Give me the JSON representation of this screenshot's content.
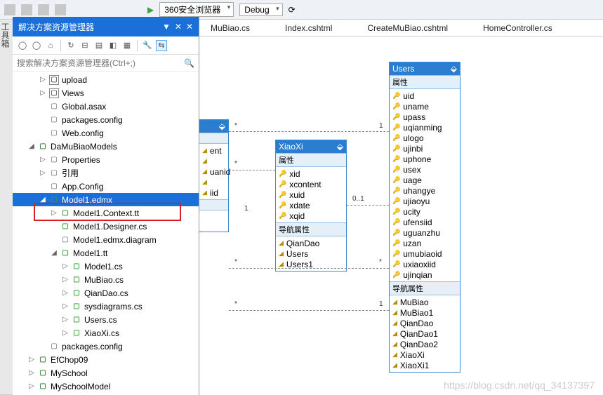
{
  "toolbar": {
    "browser": "360安全浏览器",
    "config": "Debug"
  },
  "tabs": [
    "MuBiao.cs",
    "Index.cshtml",
    "CreateMuBiao.cshtml",
    "HomeController.cs"
  ],
  "panel": {
    "title": "解决方案资源管理器",
    "search_ph": "搜索解决方案资源管理器(Ctrl+;)"
  },
  "tree": [
    {
      "d": 2,
      "a": "▷",
      "i": "f-folder",
      "t": "upload"
    },
    {
      "d": 2,
      "a": "▷",
      "i": "f-folder",
      "t": "Views"
    },
    {
      "d": 2,
      "a": "",
      "i": "f-config",
      "t": "Global.asax"
    },
    {
      "d": 2,
      "a": "",
      "i": "f-config",
      "t": "packages.config"
    },
    {
      "d": 2,
      "a": "",
      "i": "f-config",
      "t": "Web.config"
    },
    {
      "d": 1,
      "a": "◢",
      "i": "f-proj",
      "t": "DaMuBiaoModels"
    },
    {
      "d": 2,
      "a": "▷",
      "i": "f-config",
      "t": "Properties"
    },
    {
      "d": 2,
      "a": "▷",
      "i": "f-config",
      "t": "引用"
    },
    {
      "d": 2,
      "a": "",
      "i": "f-config",
      "t": "App.Config"
    },
    {
      "d": 2,
      "a": "◢",
      "i": "f-edmx",
      "t": "Model1.edmx",
      "sel": true
    },
    {
      "d": 3,
      "a": "▷",
      "i": "f-cs",
      "t": "Model1.Context.tt"
    },
    {
      "d": 3,
      "a": "",
      "i": "f-cs",
      "t": "Model1.Designer.cs"
    },
    {
      "d": 3,
      "a": "",
      "i": "f-config",
      "t": "Model1.edmx.diagram"
    },
    {
      "d": 3,
      "a": "◢",
      "i": "f-cs",
      "t": "Model1.tt"
    },
    {
      "d": 4,
      "a": "▷",
      "i": "f-cs",
      "t": "Model1.cs"
    },
    {
      "d": 4,
      "a": "▷",
      "i": "f-cs",
      "t": "MuBiao.cs"
    },
    {
      "d": 4,
      "a": "▷",
      "i": "f-cs",
      "t": "QianDao.cs"
    },
    {
      "d": 4,
      "a": "▷",
      "i": "f-cs",
      "t": "sysdiagrams.cs"
    },
    {
      "d": 4,
      "a": "▷",
      "i": "f-cs",
      "t": "Users.cs"
    },
    {
      "d": 4,
      "a": "▷",
      "i": "f-cs",
      "t": "XiaoXi.cs"
    },
    {
      "d": 2,
      "a": "",
      "i": "f-config",
      "t": "packages.config"
    },
    {
      "d": 1,
      "a": "▷",
      "i": "f-proj",
      "t": "EfChop09"
    },
    {
      "d": 1,
      "a": "▷",
      "i": "f-proj",
      "t": "MySchool"
    },
    {
      "d": 1,
      "a": "▷",
      "i": "f-proj",
      "t": "MySchoolModel"
    }
  ],
  "ent_partial": {
    "props": [
      "ent",
      "",
      "uanid",
      "",
      "iid"
    ]
  },
  "ent_xiaoxi": {
    "name": "XiaoXi",
    "sec1": "属性",
    "props": [
      "xid",
      "xcontent",
      "xuid",
      "xdate",
      "xqid"
    ],
    "sec2": "导航属性",
    "navs": [
      "QianDao",
      "Users",
      "Users1"
    ]
  },
  "ent_users": {
    "name": "Users",
    "sec1": "属性",
    "props": [
      "uid",
      "uname",
      "upass",
      "uqianming",
      "ulogo",
      "ujinbi",
      "uphone",
      "usex",
      "uage",
      "uhangye",
      "ujiaoyu",
      "ucity",
      "ufensiid",
      "uguanzhu",
      "uzan",
      "umubiaoid",
      "uxiaoxiid",
      "ujinqian"
    ],
    "sec2": "导航属性",
    "navs": [
      "MuBiao",
      "MuBiao1",
      "QianDao",
      "QianDao1",
      "QianDao2",
      "XiaoXi",
      "XiaoXi1"
    ]
  },
  "watermark": "https://blog.csdn.net/qq_34137397"
}
